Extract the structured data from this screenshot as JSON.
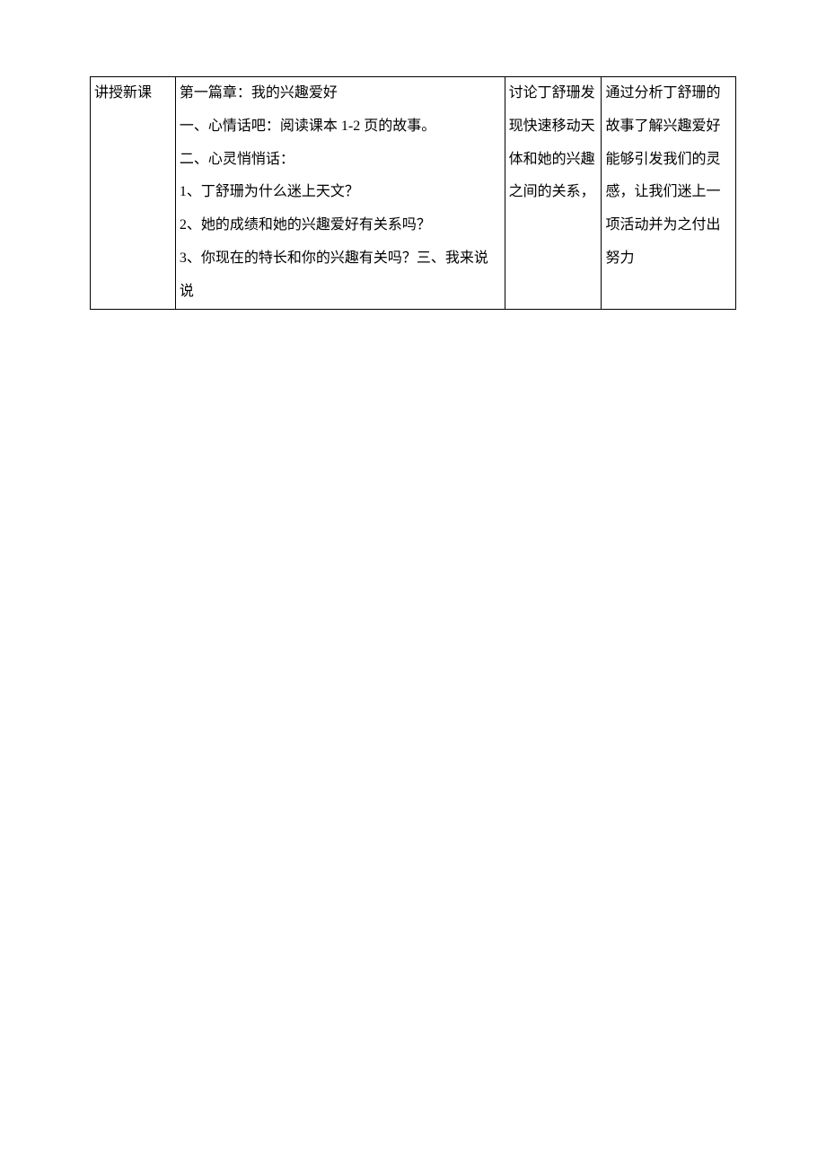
{
  "table": {
    "row1": {
      "col1": "讲授新课",
      "col2": {
        "line1": "第一篇章：我的兴趣爱好",
        "line2": "一、心情话吧：阅读课本 1-2 页的故事。",
        "line3": "二、心灵悄悄话：",
        "line4": "1、丁舒珊为什么迷上天文？",
        "line5": "2、她的成绩和她的兴趣爱好有关系吗？",
        "line6": "3、你现在的特长和你的兴趣有关吗？三、我来说",
        "line7": "  说"
      },
      "col3": "讨论丁舒珊发现快速移动天体和她的兴趣之间的关系，",
      "col4": "通过分析丁舒珊的故事了解兴趣爱好能够引发我们的灵感，让我们迷上一项活动并为之付出努力"
    }
  }
}
